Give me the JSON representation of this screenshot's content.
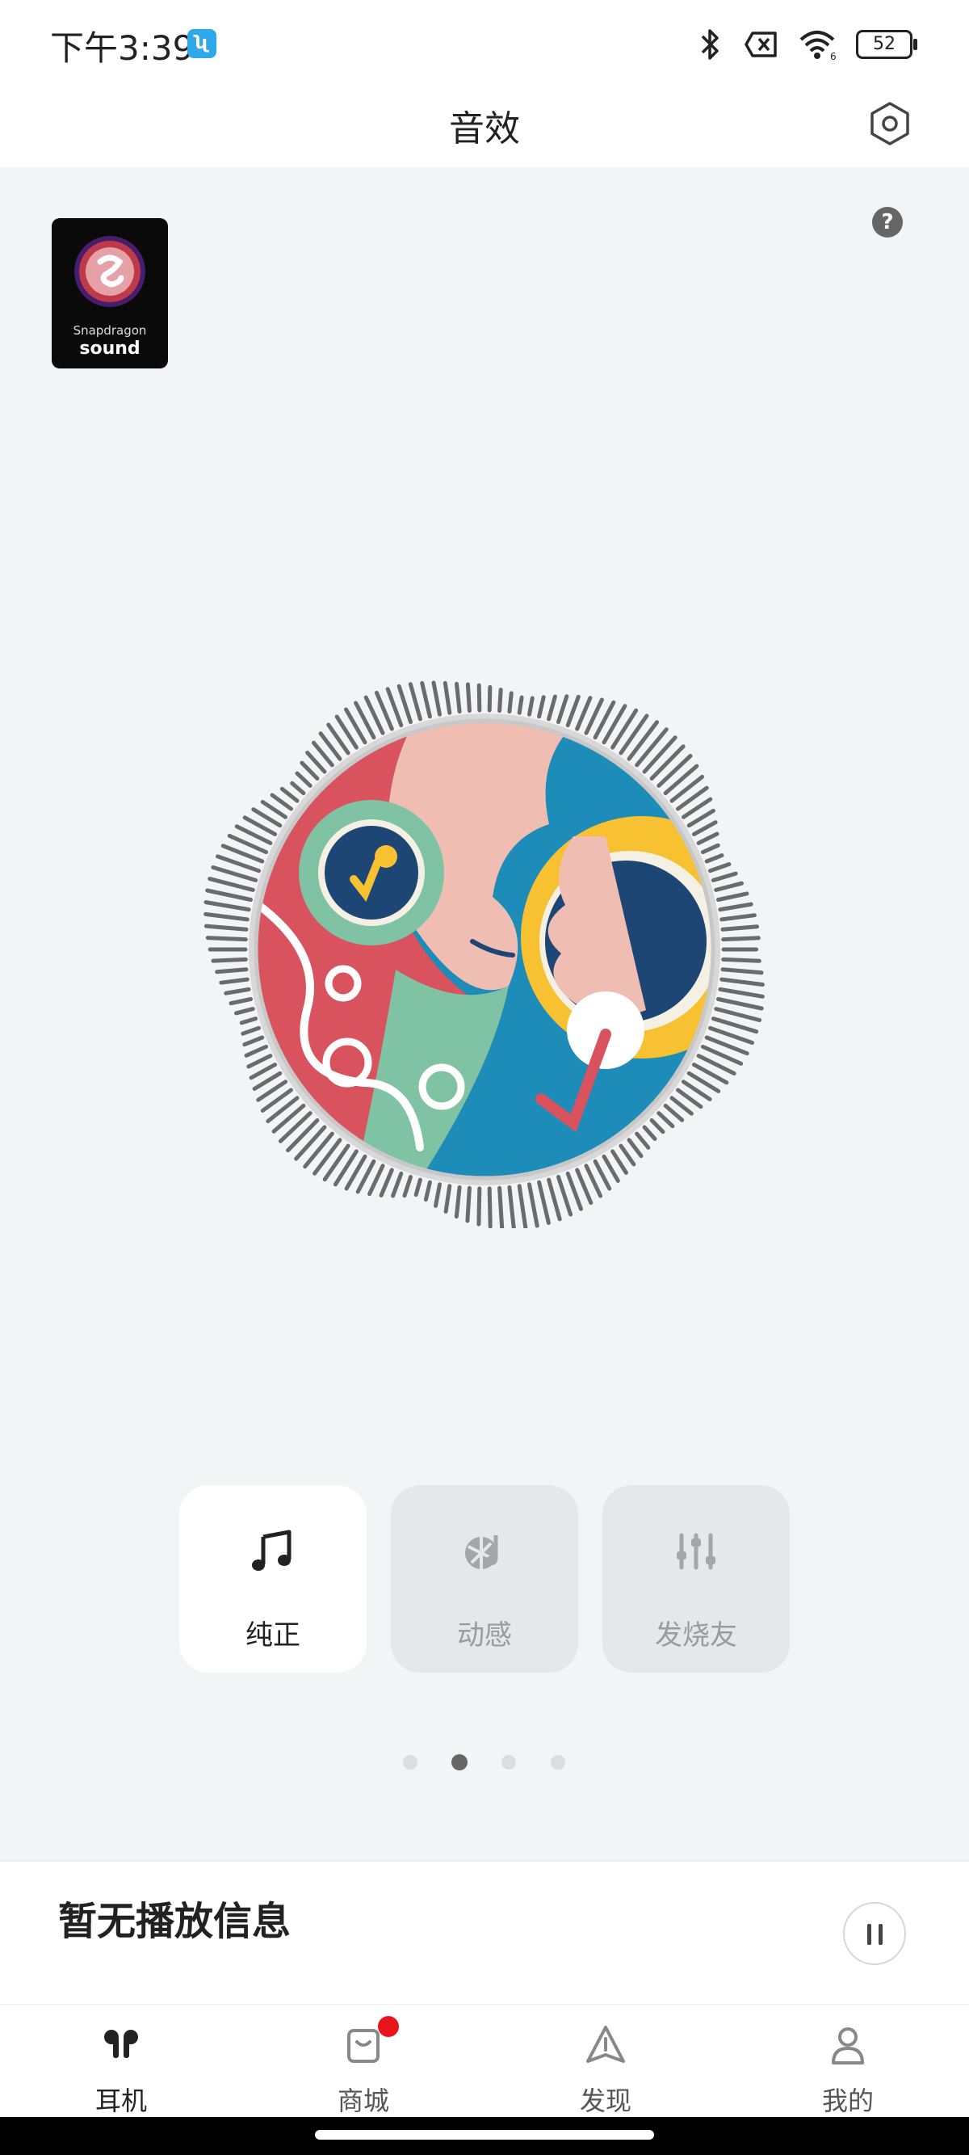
{
  "status_bar": {
    "time": "下午3:39",
    "battery": "52"
  },
  "header": {
    "title": "音效"
  },
  "logo": {
    "line1": "Snapdragon",
    "line2": "sound"
  },
  "modes": [
    {
      "label": "纯正",
      "icon": "music-note-icon",
      "active": true
    },
    {
      "label": "动感",
      "icon": "dynamic-icon",
      "active": false
    },
    {
      "label": "发烧友",
      "icon": "equalizer-icon",
      "active": false
    }
  ],
  "pager": {
    "count": 4,
    "active_index": 1
  },
  "player": {
    "now_playing": "暂无播放信息"
  },
  "tabs": [
    {
      "label": "耳机",
      "icon": "earbuds-icon",
      "active": true
    },
    {
      "label": "商城",
      "icon": "shopping-bag-icon",
      "active": false
    },
    {
      "label": "发现",
      "icon": "discover-icon",
      "active": false
    },
    {
      "label": "我的",
      "icon": "profile-icon",
      "active": false
    }
  ],
  "colors": {
    "accent_red": "#e8141b",
    "art_red": "#d9535e",
    "art_blue": "#1e8cb8",
    "art_yellow": "#f7c132",
    "art_teal": "#7fc3a4",
    "art_pink": "#f0bdb3",
    "art_navy": "#1e4675"
  }
}
